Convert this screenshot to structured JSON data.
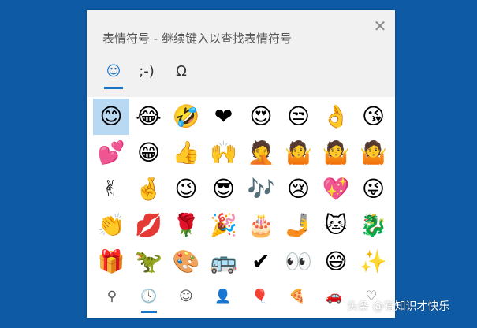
{
  "panel": {
    "title": "表情符号 - 继续键入以查找表情符号",
    "close_glyph": "✕"
  },
  "category_tabs": [
    {
      "label": "☺",
      "name": "emoji",
      "active": true
    },
    {
      "label": ";-)",
      "name": "kaomoji",
      "active": false
    },
    {
      "label": "Ω",
      "name": "symbols",
      "active": false
    }
  ],
  "emoji_rows": [
    [
      "😊",
      "😂",
      "🤣",
      "❤",
      "😍",
      "😒",
      "👌",
      "😘"
    ],
    [
      "💕",
      "😁",
      "👍",
      "🙌",
      "🤦",
      "🤷",
      "🤷",
      "🤷"
    ],
    [
      "✌",
      "🤞",
      "😉",
      "😎",
      "🎶",
      "😢",
      "💖",
      "😜"
    ],
    [
      "👏",
      "💋",
      "🌹",
      "🎉",
      "🎂",
      "🤳",
      "🐱",
      "🐉"
    ],
    [
      "🎁",
      "🦖",
      "🎨",
      "🚌",
      "✔",
      "👀",
      "😅",
      "✨"
    ]
  ],
  "bottom_tabs": [
    {
      "label": "⚲",
      "icon": "search-icon",
      "active": false
    },
    {
      "label": "🕓",
      "icon": "clock-icon",
      "active": true
    },
    {
      "label": "☺",
      "icon": "smiley-icon",
      "active": false
    },
    {
      "label": "👤",
      "icon": "person-icon",
      "active": false
    },
    {
      "label": "🎈",
      "icon": "balloon-icon",
      "active": false
    },
    {
      "label": "🍕",
      "icon": "pizza-icon",
      "active": false
    },
    {
      "label": "🚗",
      "icon": "car-icon",
      "active": false
    },
    {
      "label": "♡",
      "icon": "heart-icon",
      "active": false
    }
  ],
  "watermark": "头条 @有知识才快乐",
  "colors": {
    "background": "#0e5aa4",
    "accent": "#1a73c7",
    "selected": "#b9d8f2"
  }
}
